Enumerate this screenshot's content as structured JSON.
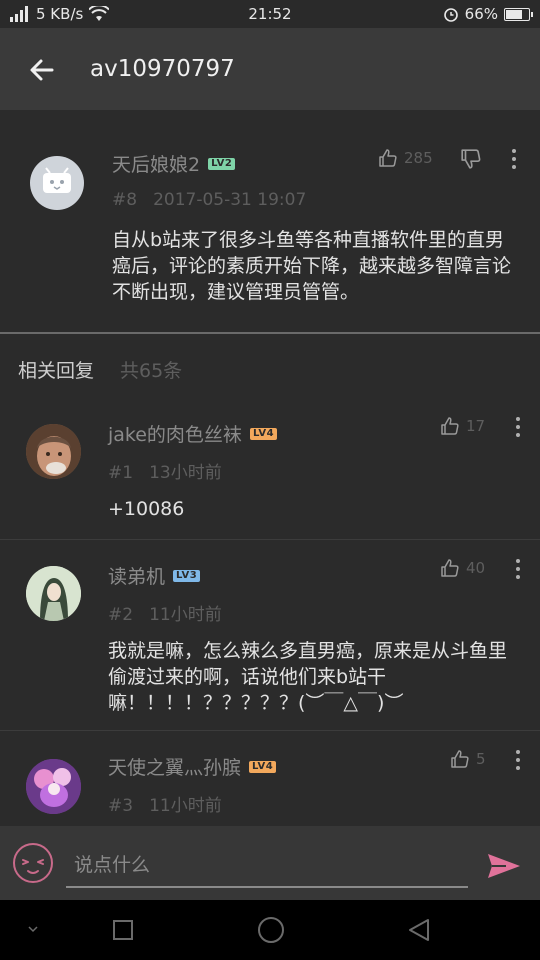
{
  "status_bar": {
    "signal": "4G",
    "net_speed": "5 KB/s",
    "time": "21:52",
    "battery": "66%",
    "battery_level": 0.66
  },
  "app_bar": {
    "title": "av10970797"
  },
  "main_comment": {
    "username": "天后娘娘2",
    "level": "LV2",
    "floor": "#8",
    "datetime": "2017-05-31 19:07",
    "likes": "285",
    "text": "自从b站来了很多斗鱼等各种直播软件里的直男癌后，评论的素质开始下降，越来越多智障言论不断出现，建议管理员管管。"
  },
  "replies_header": {
    "title": "相关回复",
    "count": "共65条"
  },
  "replies": [
    {
      "username": "jake的肉色丝袜",
      "level": "LV4",
      "floor": "#1",
      "time": "13小时前",
      "likes": "17",
      "text": "+10086"
    },
    {
      "username": "读弟机",
      "level": "LV3",
      "floor": "#2",
      "time": "11小时前",
      "likes": "40",
      "text": "我就是嘛，怎么辣么多直男癌，原来是从斗鱼里偷渡过来的啊，话说他们来b站干嘛！！！！？？？？？(︶￣△￣)︶"
    },
    {
      "username": "天使之翼灬孙膑",
      "level": "LV4",
      "floor": "#3",
      "time": "11小时前",
      "likes": "5",
      "text": ""
    }
  ],
  "input_bar": {
    "placeholder": "说点什么"
  },
  "colors": {
    "background": "#2b2b2b",
    "app_bar": "#3a3a3a",
    "lv2": "#7fd4a8",
    "lv3": "#7fb8e8",
    "lv4": "#f2a85c",
    "send": "#e0729a"
  }
}
